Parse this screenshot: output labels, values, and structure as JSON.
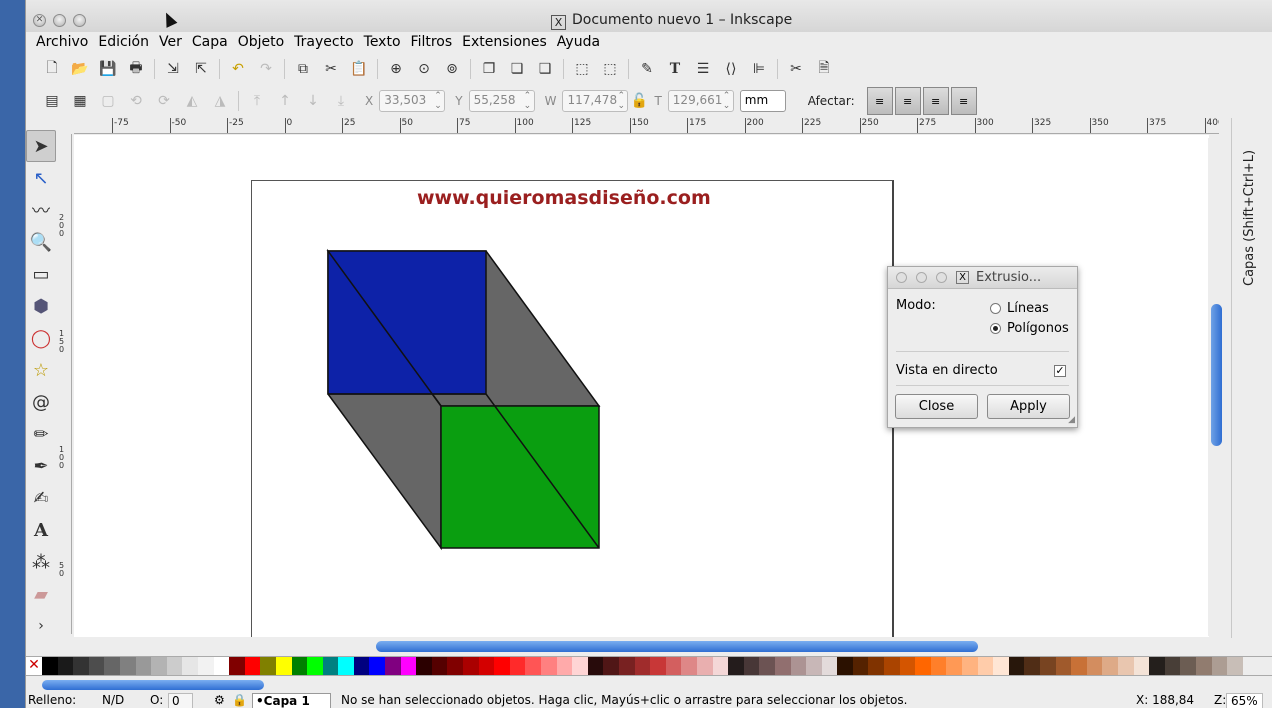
{
  "window": {
    "title": "Documento nuevo 1 – Inkscape",
    "title_icon": "x11-icon"
  },
  "menu": [
    {
      "label": "Archivo"
    },
    {
      "label": "Edición"
    },
    {
      "label": "Ver"
    },
    {
      "label": "Capa"
    },
    {
      "label": "Objeto"
    },
    {
      "label": "Trayecto"
    },
    {
      "label": "Texto"
    },
    {
      "label": "Filtros"
    },
    {
      "label": "Extensiones"
    },
    {
      "label": "Ayuda"
    }
  ],
  "selectbar": {
    "x_label": "X",
    "x_value": "33,503",
    "y_label": "Y",
    "y_value": "55,258",
    "w_label": "W",
    "w_value": "117,478",
    "h_label": "T",
    "h_value": "129,661",
    "unit": "mm",
    "affect_label": "Afectar:"
  },
  "ruler": {
    "h_ticks": [
      "-75",
      "-50",
      "-25",
      "0",
      "25",
      "50",
      "75",
      "100",
      "125",
      "150",
      "175",
      "200",
      "225",
      "250",
      "275",
      "300",
      "325",
      "350",
      "375",
      "400"
    ],
    "v_ticks": [
      "2 0 0",
      "1 5 0",
      "1 0 0",
      "5 0"
    ]
  },
  "canvas": {
    "watermark": "www.quieromasdiseño.com",
    "colors": {
      "blue": "#0d22a8",
      "green": "#0a9e10",
      "gray": "#666666",
      "watermark": "#9a1f1f"
    }
  },
  "layers_panel": {
    "label": "Capas (Shift+Ctrl+L)"
  },
  "dialog": {
    "title": "Extrusio...",
    "mode_label": "Modo:",
    "options": [
      {
        "label": "Líneas",
        "selected": false
      },
      {
        "label": "Polígonos",
        "selected": true
      }
    ],
    "live_preview_label": "Vista en directo",
    "live_preview_checked": true,
    "close_label": "Close",
    "apply_label": "Apply"
  },
  "palette": [
    "#000000",
    "#1a1a1a",
    "#333333",
    "#4d4d4d",
    "#666666",
    "#808080",
    "#999999",
    "#b3b3b3",
    "#cccccc",
    "#e6e6e6",
    "#f2f2f2",
    "#ffffff",
    "#800000",
    "#ff0000",
    "#808000",
    "#ffff00",
    "#008000",
    "#00ff00",
    "#008080",
    "#00ffff",
    "#000080",
    "#0000ff",
    "#800080",
    "#ff00ff",
    "#2b0000",
    "#550000",
    "#800000",
    "#aa0000",
    "#d40000",
    "#ff0000",
    "#ff2a2a",
    "#ff5555",
    "#ff8080",
    "#ffaaaa",
    "#ffd5d5",
    "#280b0b",
    "#501616",
    "#782121",
    "#a02c2c",
    "#c83737",
    "#d35f5f",
    "#de8787",
    "#e9afaf",
    "#f4d7d7",
    "#241c1c",
    "#483737",
    "#6c5353",
    "#916f6f",
    "#ac9393",
    "#c8b7b7",
    "#e3dbdb",
    "#2b1100",
    "#552200",
    "#803300",
    "#aa4400",
    "#d45500",
    "#ff6600",
    "#ff7f2a",
    "#ff9955",
    "#ffb380",
    "#ffccaa",
    "#ffe6d5",
    "#28170b",
    "#502d16",
    "#784421",
    "#a05a2c",
    "#c87137",
    "#d38d5f",
    "#deaa87",
    "#e9c6af",
    "#f4e3d7",
    "#241f1c",
    "#483e37",
    "#6c5d53",
    "#917c6f",
    "#ac9d93",
    "#c8beb7"
  ],
  "status": {
    "fill_label": "Relleno:",
    "fill_value": "N/D",
    "opacity_label": "O:",
    "opacity_value": "0",
    "layer": "•Capa 1",
    "message": "No se han seleccionado objetos. Haga clic, Mayús+clic o arrastre para seleccionar los objetos.",
    "coords": "X: 188,84",
    "zoom_label": "Z:",
    "zoom_value": "65%"
  }
}
